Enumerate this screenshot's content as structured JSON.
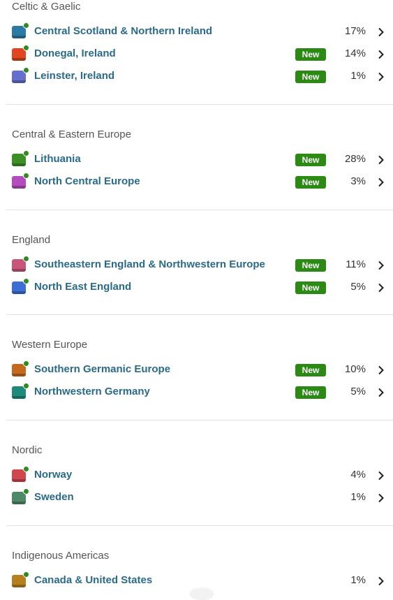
{
  "new_label": "New",
  "icons": {
    "row_arrow": "chevron-right-icon",
    "region_swatch": "region-color-icon",
    "recent_dot": "green-dot-indicator"
  },
  "groups": [
    {
      "title": "Celtic & Gaelic",
      "items": [
        {
          "name": "Central Scotland & Northern Ireland",
          "percent": "17%",
          "is_new": false,
          "color": "#2a7ba4"
        },
        {
          "name": "Donegal, Ireland",
          "percent": "14%",
          "is_new": true,
          "color": "#e0461f"
        },
        {
          "name": "Leinster, Ireland",
          "percent": "1%",
          "is_new": true,
          "color": "#6570cc"
        }
      ]
    },
    {
      "title": "Central & Eastern Europe",
      "items": [
        {
          "name": "Lithuania",
          "percent": "28%",
          "is_new": true,
          "color": "#3c8f24"
        },
        {
          "name": "North Central Europe",
          "percent": "3%",
          "is_new": true,
          "color": "#b54bbf"
        }
      ]
    },
    {
      "title": "England",
      "items": [
        {
          "name": "Southeastern England & Northwestern Europe",
          "percent": "11%",
          "is_new": true,
          "color": "#c9567a"
        },
        {
          "name": "North East England",
          "percent": "5%",
          "is_new": true,
          "color": "#3b6fd6"
        }
      ]
    },
    {
      "title": "Western Europe",
      "items": [
        {
          "name": "Southern Germanic Europe",
          "percent": "10%",
          "is_new": true,
          "color": "#c46a1c"
        },
        {
          "name": "Northwestern Germany",
          "percent": "5%",
          "is_new": true,
          "color": "#1d8a7b"
        }
      ]
    },
    {
      "title": "Nordic",
      "items": [
        {
          "name": "Norway",
          "percent": "4%",
          "is_new": false,
          "color": "#d1474e"
        },
        {
          "name": "Sweden",
          "percent": "1%",
          "is_new": false,
          "color": "#4f8a68"
        }
      ]
    },
    {
      "title": "Indigenous Americas",
      "items": [
        {
          "name": "Canada & United States",
          "percent": "1%",
          "is_new": false,
          "color": "#b7801e"
        }
      ]
    }
  ]
}
